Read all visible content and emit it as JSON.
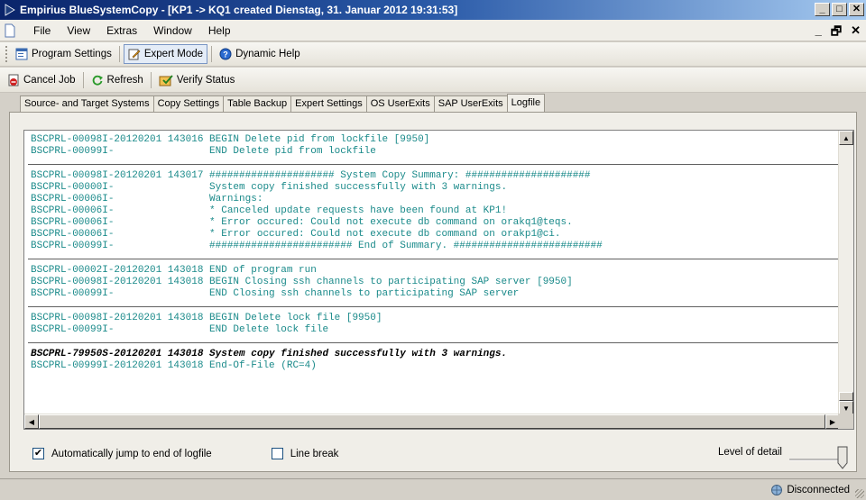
{
  "window": {
    "title": "Empirius BlueSystemCopy - [KP1 -> KQ1 created Dienstag, 31. Januar 2012 19:31:53]",
    "controls": [
      "_",
      "□",
      "X"
    ],
    "mdi_controls": [
      "_",
      "🗗",
      "x"
    ]
  },
  "menu": [
    "File",
    "View",
    "Extras",
    "Window",
    "Help"
  ],
  "toolbar1": {
    "program_settings": "Program Settings",
    "expert_mode": "Expert Mode",
    "dynamic_help": "Dynamic Help"
  },
  "toolbar2": {
    "cancel_job": "Cancel Job",
    "refresh": "Refresh",
    "verify_status": "Verify Status"
  },
  "tabs": [
    {
      "label": "Source- and Target Systems",
      "active": false
    },
    {
      "label": "Copy Settings",
      "active": false
    },
    {
      "label": "Table Backup",
      "active": false
    },
    {
      "label": "Expert Settings",
      "active": false
    },
    {
      "label": "OS UserExits",
      "active": false
    },
    {
      "label": "SAP UserExits",
      "active": false
    },
    {
      "label": "Logfile",
      "active": true
    }
  ],
  "log": {
    "blocks": [
      [
        "BSCPRL-00098I-20120201 143016 BEGIN Delete pid from lockfile [9950]",
        "BSCPRL-00099I-                END Delete pid from lockfile"
      ],
      [
        "BSCPRL-00098I-20120201 143017 ##################### System Copy Summary: #####################",
        "BSCPRL-00000I-                System copy finished successfully with 3 warnings.",
        "BSCPRL-00006I-                Warnings:",
        "BSCPRL-00006I-                * Canceled update requests have been found at KP1!",
        "BSCPRL-00006I-                * Error occured: Could not execute db command on orakq1@teqs.",
        "BSCPRL-00006I-                * Error occured: Could not execute db command on orakp1@ci.",
        "BSCPRL-00099I-                ######################## End of Summary. #########################"
      ],
      [
        "BSCPRL-00002I-20120201 143018 END of program run",
        "BSCPRL-00098I-20120201 143018 BEGIN Closing ssh channels to participating SAP server [9950]",
        "BSCPRL-00099I-                END Closing ssh channels to participating SAP server"
      ],
      [
        "BSCPRL-00098I-20120201 143018 BEGIN Delete lock file [9950]",
        "BSCPRL-00099I-                END Delete lock file"
      ]
    ],
    "final_bold": "BSCPRL-79950S-20120201 143018 System copy finished successfully with 3 warnings.",
    "final_line": "BSCPRL-00999I-20120201 143018 End-Of-File (RC=4)"
  },
  "options": {
    "auto_jump_label": "Automatically jump to end of logfile",
    "auto_jump_checked": true,
    "line_break_label": "Line break",
    "line_break_checked": false,
    "level_of_detail_label": "Level of detail",
    "level_of_detail_value": 1.0
  },
  "status": {
    "text": "Disconnected"
  }
}
